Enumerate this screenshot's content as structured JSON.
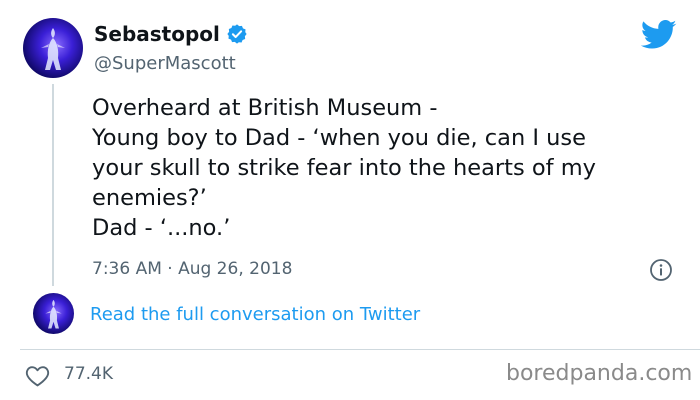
{
  "tweet": {
    "author": {
      "display_name": "Sebastopol",
      "handle": "@SuperMascott",
      "verified_icon": "verified-badge-icon",
      "avatar": "avatar"
    },
    "text_lines": [
      "Overheard at British Museum -",
      "Young boy to Dad - ‘when you die, can I use",
      "your skull to strike fear into the hearts of my",
      "enemies?’",
      "Dad - ‘...no.’"
    ],
    "timestamp": "7:36 AM · Aug 26, 2018",
    "info_icon": "info-icon",
    "read_conversation_label": "Read the full conversation on Twitter",
    "likes": {
      "icon": "heart-icon",
      "count": "77.4K"
    },
    "platform_logo": "twitter-bird-icon"
  },
  "watermark": "boredpanda.com",
  "colors": {
    "link": "#1d9bf0",
    "verified": "#1d9bf0",
    "secondary_text": "#536471",
    "divider": "#cfd9de"
  }
}
